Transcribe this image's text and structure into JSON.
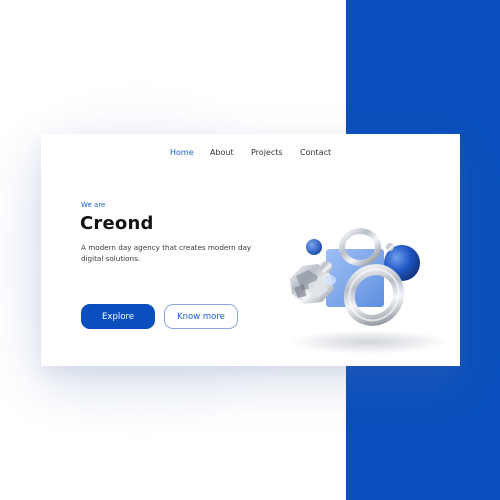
{
  "nav": {
    "items": [
      {
        "label": "Home",
        "active": true
      },
      {
        "label": "About",
        "active": false
      },
      {
        "label": "Projects",
        "active": false
      },
      {
        "label": "Contact",
        "active": false
      }
    ]
  },
  "hero": {
    "eyebrow": "We are",
    "title": "Creond",
    "description": "A modern day agency that creates modern day digital solutions.",
    "primary_button": "Explore",
    "secondary_button": "Know more"
  },
  "colors": {
    "brand_blue": "#0a4fbd",
    "accent_blue": "#1b5fd1",
    "text_dark": "#141414"
  },
  "artwork": {
    "icon": "abstract-3d-shapes-illustration"
  }
}
